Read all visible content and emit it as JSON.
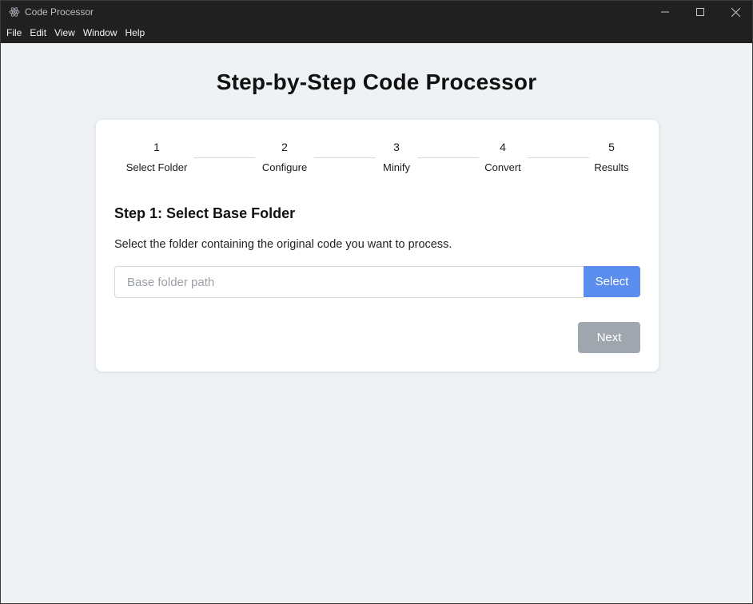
{
  "window": {
    "title": "Code Processor",
    "icon": "electron-atom-icon",
    "controls": [
      "minimize-icon",
      "maximize-icon",
      "close-icon"
    ]
  },
  "menu": [
    "File",
    "Edit",
    "View",
    "Window",
    "Help"
  ],
  "page": {
    "title": "Step-by-Step Code Processor"
  },
  "steps": [
    {
      "number": "1",
      "label": "Select Folder"
    },
    {
      "number": "2",
      "label": "Configure"
    },
    {
      "number": "3",
      "label": "Minify"
    },
    {
      "number": "4",
      "label": "Convert"
    },
    {
      "number": "5",
      "label": "Results"
    }
  ],
  "current_step": {
    "heading": "Step 1: Select Base Folder",
    "description": "Select the folder containing the original code you want to process.",
    "input_placeholder": "Base folder path",
    "input_value": "",
    "select_label": "Select",
    "next_label": "Next",
    "next_enabled": false
  },
  "colors": {
    "titlebar": "#202020",
    "background": "#eff2f4",
    "accent": "#5b8def",
    "disabled_button": "#a0a6ae"
  }
}
